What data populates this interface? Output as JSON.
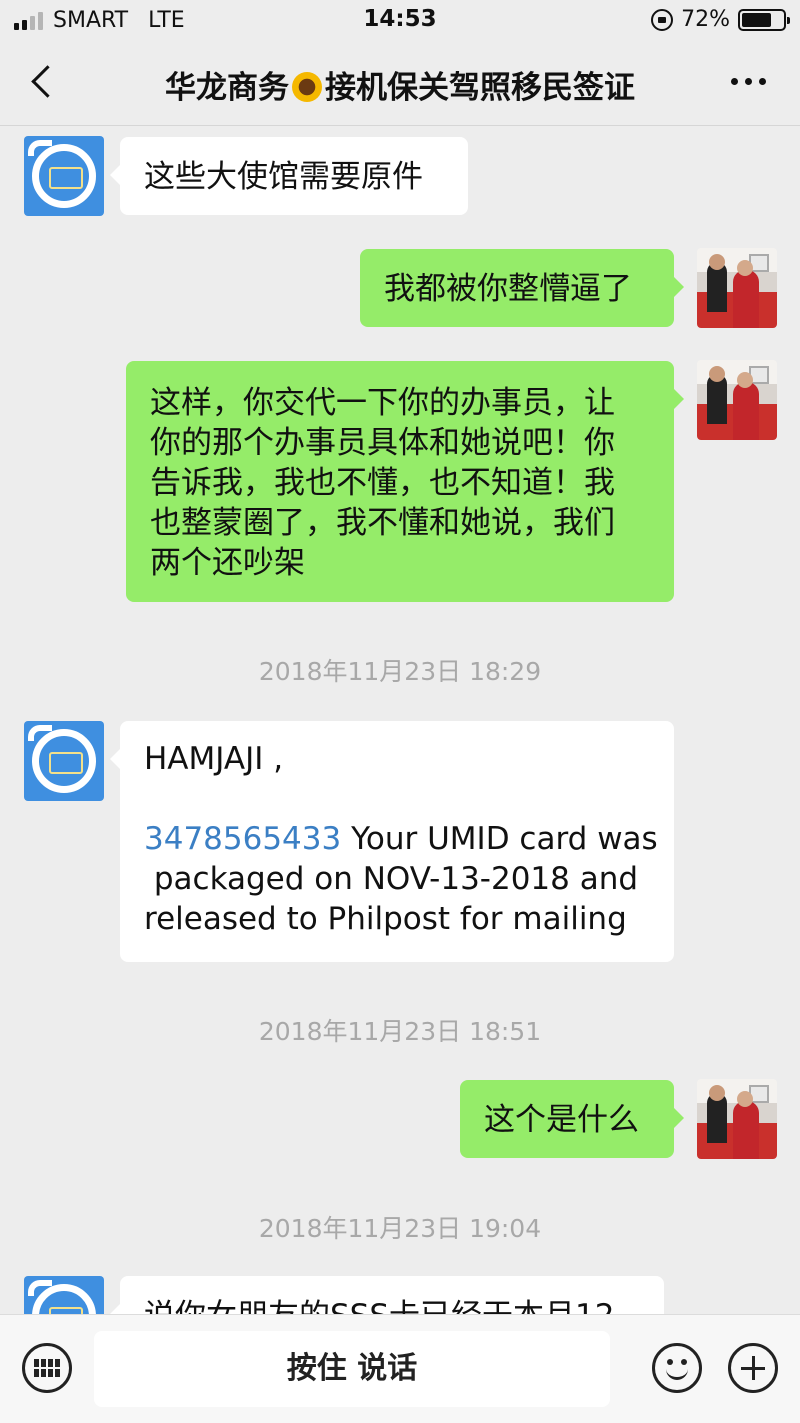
{
  "status_bar": {
    "carrier": "SMART",
    "network": "LTE",
    "time": "14:53",
    "battery_percent": "72%",
    "battery_level": 0.72,
    "signal_bars_active": 2,
    "signal_bars_total": 4
  },
  "navbar": {
    "title_part1": "华龙商务",
    "title_icon": "sunflower-emoji",
    "title_part2": "接机保关驾照移民签证"
  },
  "messages": [
    {
      "sender": "business",
      "lines": [
        "这些大使馆需要原件"
      ]
    },
    {
      "sender": "me",
      "lines": [
        "我都被你整懵逼了"
      ]
    },
    {
      "sender": "me",
      "lines": [
        "这样，你交代一下你的办事员，让",
        "你的那个办事员具体和她说吧！你",
        "告诉我，我也不懂，也不知道！我",
        "也整蒙圈了，我不懂和她说，我们",
        "两个还吵架"
      ]
    },
    {
      "sender": "timestamp",
      "text": "2018年11月23日 18:29"
    },
    {
      "sender": "business",
      "greeting": "HAMJAJI ,",
      "phone": "3478565433",
      "line1_rest": " Your UMID card was",
      "line2": " packaged on NOV-13-2018 and",
      "line3": "released to Philpost for mailing"
    },
    {
      "sender": "timestamp",
      "text": "2018年11月23日 18:51"
    },
    {
      "sender": "me",
      "lines": [
        "这个是什么"
      ]
    },
    {
      "sender": "timestamp",
      "text": "2018年11月23日 19:04"
    },
    {
      "sender": "business",
      "lines": [
        "说你女朋友的SSS卡已经于本月12"
      ]
    }
  ],
  "input_bar": {
    "talk_label": "按住 说话"
  },
  "colors": {
    "background": "#ededed",
    "bubble_me": "#95ec69",
    "bubble_other": "#ffffff",
    "link": "#3b7fc4"
  }
}
